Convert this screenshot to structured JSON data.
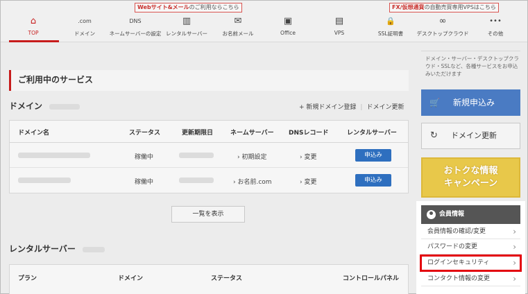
{
  "promos": {
    "left_bold": "Webサイト&メール",
    "left_rest": "のご利用ならこちら",
    "right_bold": "FX/仮想通貨",
    "right_rest": "の自動売買専用VPSはこちら"
  },
  "nav": [
    {
      "label": "TOP",
      "icon": "home-icon",
      "glyph": "⌂"
    },
    {
      "label": "ドメイン",
      "icon": "dotcom-icon",
      "glyph": ".com"
    },
    {
      "label": "ネームサーバーの設定",
      "icon": "dns-icon",
      "glyph": "DNS"
    },
    {
      "label": "レンタルサーバー",
      "icon": "server-icon",
      "glyph": "▥"
    },
    {
      "label": "お名前メール",
      "icon": "mail-icon",
      "glyph": "✉"
    },
    {
      "label": "Office",
      "icon": "office-icon",
      "glyph": "▣"
    },
    {
      "label": "VPS",
      "icon": "vps-icon",
      "glyph": "▤"
    },
    {
      "label": "SSL証明書",
      "icon": "lock-icon",
      "glyph": "🔒"
    },
    {
      "label": "デスクトップクラウド",
      "icon": "cloud-icon",
      "glyph": "∞"
    },
    {
      "label": "その他",
      "icon": "more-icon",
      "glyph": "•••"
    }
  ],
  "main": {
    "section_title": "ご利用中のサービス",
    "domain_heading": "ドメイン",
    "domain_actions": {
      "add": "+ 新規ドメイン登録",
      "renew": "ドメイン更新"
    },
    "domain_table": {
      "headers": [
        "ドメイン名",
        "ステータス",
        "更新期限日",
        "ネームサーバー",
        "DNSレコード",
        "レンタルサーバー"
      ],
      "rows": [
        {
          "status": "稼働中",
          "nameserver": "› 初期設定",
          "dns": "› 変更",
          "apply": "申込み"
        },
        {
          "status": "稼働中",
          "nameserver": "› お名前.com",
          "dns": "› 変更",
          "apply": "申込み"
        }
      ]
    },
    "list_button": "一覧を表示",
    "rental_heading": "レンタルサーバー",
    "rental_table": {
      "headers": [
        "プラン",
        "ドメイン",
        "ステータス",
        "コントロールパネル"
      ]
    }
  },
  "sidebar": {
    "note": "ドメイン・サーバー・デスクトップクラウド・SSLなど、各種サービスをお申込みいただけます",
    "new_button": "新規申込み",
    "renew_button": "ドメイン更新",
    "campaign_line1": "おトクな情報",
    "campaign_line2": "キャンペーン",
    "member": {
      "heading": "会員情報",
      "items": [
        "会員情報の確認/変更",
        "パスワードの変更",
        "ログインセキュリティ",
        "コンタクト情報の変更"
      ]
    }
  },
  "colors": {
    "accent": "#c71c1c",
    "primary_button": "#4a7bc3",
    "highlight": "#e3000b"
  }
}
